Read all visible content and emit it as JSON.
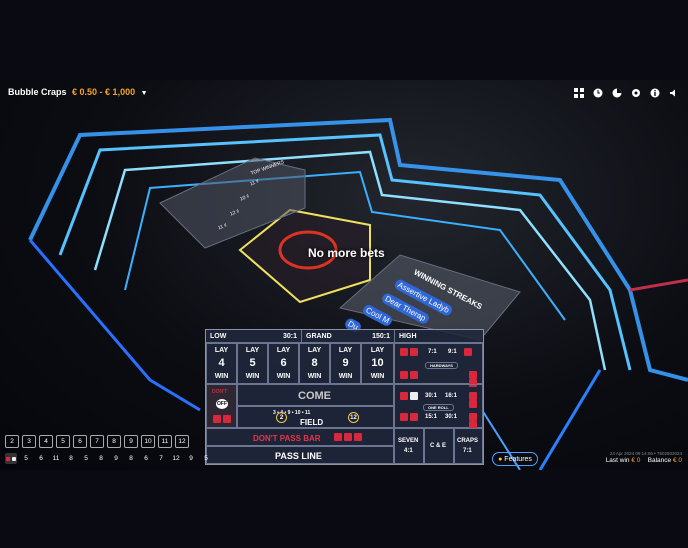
{
  "header": {
    "title": "Bubble Craps",
    "limits": "€ 0.50 - € 1,000",
    "caret": "▼"
  },
  "toolbar": {
    "icons": [
      "grid-icon",
      "history-icon",
      "stats-icon",
      "settings-icon",
      "info-icon",
      "volume-icon"
    ]
  },
  "status": {
    "message": "No more bets"
  },
  "top_winners": {
    "title": "TOP WINNERS",
    "amounts": [
      "11 ₫",
      "10 ₫",
      "12 ₫",
      "11 ₫"
    ]
  },
  "winning_streaks": {
    "title": "WINNING STREAKS",
    "names": [
      "Assertive Ladyb",
      "Dear Therap",
      "Cool M",
      "Du"
    ]
  },
  "bet_table": {
    "low": "LOW",
    "low_odds": "30:1",
    "grand": "GRAND",
    "grand_odds": "150:1",
    "high": "HIGH",
    "lay": "LAY",
    "win": "WIN",
    "numbers": [
      "4",
      "5",
      "6",
      "8",
      "9",
      "10"
    ],
    "hardways": "HARDWAYS",
    "hard_odds": [
      "7:1",
      "9:1",
      "30:1",
      "16:1",
      "15:1",
      "30:1"
    ],
    "one_roll": "ONE ROLL",
    "come": "COME",
    "dont": "DON'T",
    "off": "OFF",
    "field": "FIELD",
    "field_nums": "3 • 4 • 9 • 10 • 11",
    "field_2": "2",
    "field_12": "12",
    "dont_pass": "DON'T PASS BAR",
    "pass": "PASS LINE",
    "seven": "SEVEN",
    "seven_odds": "4:1",
    "ce": "C & E",
    "craps": "CRAPS",
    "craps_odds": "7:1"
  },
  "history": {
    "buttons": [
      "2",
      "3",
      "4",
      "5",
      "6",
      "7",
      "8",
      "9",
      "10",
      "11",
      "12"
    ],
    "results": [
      "5",
      "6",
      "11",
      "8",
      "5",
      "8",
      "9",
      "8",
      "6",
      "7",
      "12",
      "9",
      "5"
    ]
  },
  "features_label": "Features",
  "wallet": {
    "timestamp": "24 Apr 2024 09:14:06 • 7502502024",
    "last_win_label": "Last win",
    "last_win": "€ 0",
    "balance_label": "Balance",
    "balance": "€ 0"
  }
}
